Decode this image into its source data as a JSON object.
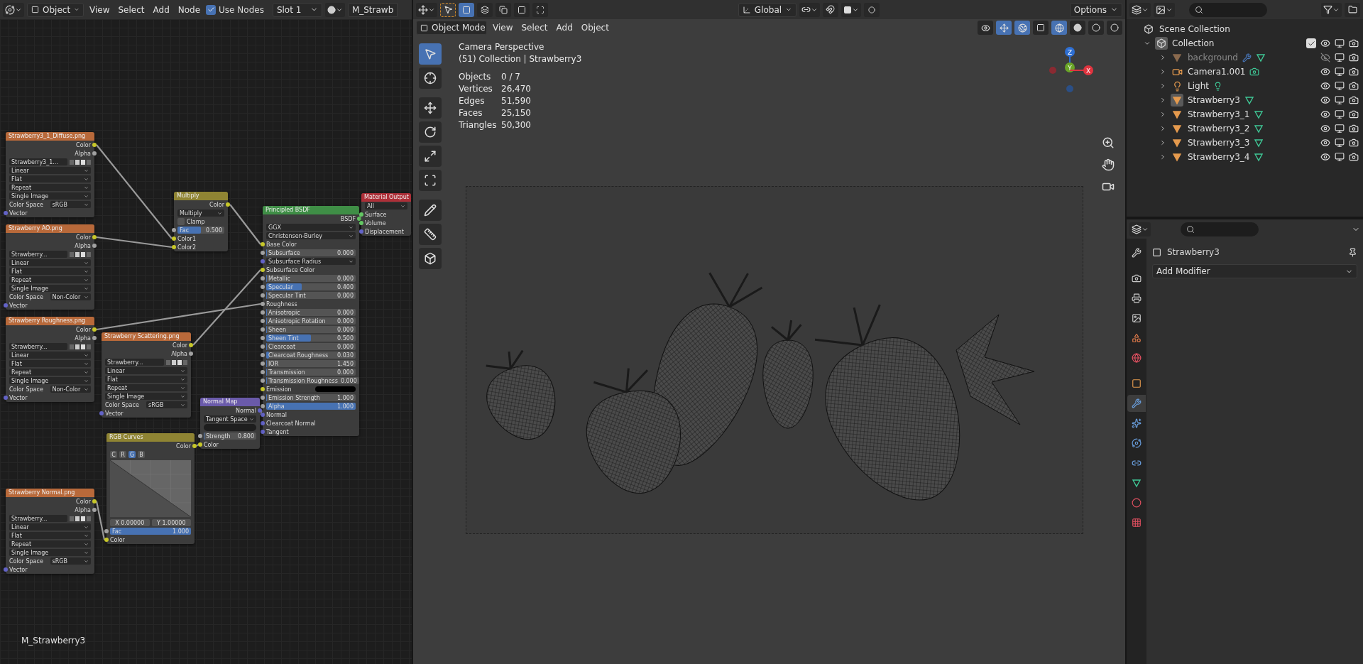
{
  "node_editor": {
    "header": {
      "mode": "Object",
      "menus": [
        "View",
        "Select",
        "Add",
        "Node"
      ],
      "use_nodes": {
        "label": "Use Nodes",
        "checked": true
      },
      "slot": "Slot 1",
      "material": "M_Strawb"
    },
    "nodes": [
      {
        "title": "Strawberry3_1_Diffuse.png",
        "color": "#b8693a",
        "rows": [
          {
            "kind": "out",
            "label": "Color",
            "color": "#c7c729"
          },
          {
            "kind": "out",
            "label": "Alpha",
            "color": "#a1a1a1"
          },
          {
            "kind": "image",
            "value": "Strawberry3_1..."
          },
          {
            "kind": "select",
            "value": "Linear"
          },
          {
            "kind": "select",
            "value": "Flat"
          },
          {
            "kind": "select",
            "value": "Repeat"
          },
          {
            "kind": "select",
            "value": "Single Image"
          },
          {
            "kind": "prop",
            "label": "Color Space",
            "value": "sRGB"
          },
          {
            "kind": "in",
            "label": "Vector",
            "color": "#6363c7"
          }
        ]
      },
      {
        "title": "Strawberry AO.png",
        "color": "#b8693a",
        "rows": [
          {
            "kind": "out",
            "label": "Color",
            "color": "#c7c729"
          },
          {
            "kind": "out",
            "label": "Alpha",
            "color": "#a1a1a1"
          },
          {
            "kind": "image",
            "value": "Strawberry..."
          },
          {
            "kind": "select",
            "value": "Linear"
          },
          {
            "kind": "select",
            "value": "Flat"
          },
          {
            "kind": "select",
            "value": "Repeat"
          },
          {
            "kind": "select",
            "value": "Single Image"
          },
          {
            "kind": "prop",
            "label": "Color Space",
            "value": "Non-Color"
          },
          {
            "kind": "in",
            "label": "Vector",
            "color": "#6363c7"
          }
        ]
      },
      {
        "title": "Strawberry Roughness.png",
        "color": "#b8693a",
        "rows": [
          {
            "kind": "out",
            "label": "Color",
            "color": "#c7c729"
          },
          {
            "kind": "out",
            "label": "Alpha",
            "color": "#a1a1a1"
          },
          {
            "kind": "image",
            "value": "Strawberry..."
          },
          {
            "kind": "select",
            "value": "Linear"
          },
          {
            "kind": "select",
            "value": "Flat"
          },
          {
            "kind": "select",
            "value": "Repeat"
          },
          {
            "kind": "select",
            "value": "Single Image"
          },
          {
            "kind": "prop",
            "label": "Color Space",
            "value": "Non-Color"
          },
          {
            "kind": "in",
            "label": "Vector",
            "color": "#6363c7"
          }
        ]
      },
      {
        "title": "Strawberry Scattering.png",
        "color": "#b8693a",
        "rows": [
          {
            "kind": "out",
            "label": "Color",
            "color": "#c7c729"
          },
          {
            "kind": "out",
            "label": "Alpha",
            "color": "#a1a1a1"
          },
          {
            "kind": "image",
            "value": "Strawberry..."
          },
          {
            "kind": "select",
            "value": "Linear"
          },
          {
            "kind": "select",
            "value": "Flat"
          },
          {
            "kind": "select",
            "value": "Repeat"
          },
          {
            "kind": "select",
            "value": "Single Image"
          },
          {
            "kind": "prop",
            "label": "Color Space",
            "value": "sRGB"
          },
          {
            "kind": "in",
            "label": "Vector",
            "color": "#6363c7"
          }
        ]
      },
      {
        "title": "Multiply",
        "color": "#8f8433",
        "rows": [
          {
            "kind": "out",
            "label": "Color",
            "color": "#c7c729"
          },
          {
            "kind": "select",
            "value": "Multiply"
          },
          {
            "kind": "check",
            "label": "Clamp",
            "checked": false
          },
          {
            "kind": "slider",
            "label": "Fac",
            "value": "0.500",
            "level": 0.5
          },
          {
            "kind": "in",
            "label": "Color1",
            "color": "#c7c729"
          },
          {
            "kind": "in",
            "label": "Color2",
            "color": "#c7c729"
          }
        ]
      },
      {
        "title": "Principled BSDF",
        "color": "#3f8e46",
        "rows": [
          {
            "kind": "out",
            "label": "BSDF",
            "color": "#63c763"
          },
          {
            "kind": "select",
            "value": "GGX"
          },
          {
            "kind": "select",
            "value": "Christensen-Burley"
          },
          {
            "kind": "in",
            "label": "Base Color",
            "color": "#c7c729"
          },
          {
            "kind": "slider",
            "label": "Subsurface",
            "value": "0.000",
            "level": 0
          },
          {
            "kind": "select",
            "value": "Subsurface Radius",
            "color": "#6363c7"
          },
          {
            "kind": "in",
            "label": "Subsurface Color",
            "color": "#c7c729"
          },
          {
            "kind": "slider",
            "label": "Metallic",
            "value": "0.000",
            "level": 0
          },
          {
            "kind": "slider",
            "label": "Specular",
            "value": "0.400",
            "level": 0.4
          },
          {
            "kind": "slider",
            "label": "Specular Tint",
            "value": "0.000",
            "level": 0
          },
          {
            "kind": "in",
            "label": "Roughness",
            "color": "#a1a1a1"
          },
          {
            "kind": "slider",
            "label": "Anisotropic",
            "value": "0.000",
            "level": 0
          },
          {
            "kind": "slider",
            "label": "Anisotropic Rotation",
            "value": "0.000",
            "level": 0
          },
          {
            "kind": "slider",
            "label": "Sheen",
            "value": "0.000",
            "level": 0
          },
          {
            "kind": "slider",
            "label": "Sheen Tint",
            "value": "0.500",
            "level": 0.5
          },
          {
            "kind": "slider",
            "label": "Clearcoat",
            "value": "0.000",
            "level": 0
          },
          {
            "kind": "slider",
            "label": "Clearcoat Roughness",
            "value": "0.030",
            "level": 0.03
          },
          {
            "kind": "slider",
            "label": "IOR",
            "value": "1.450",
            "level": 0
          },
          {
            "kind": "slider",
            "label": "Transmission",
            "value": "0.000",
            "level": 0
          },
          {
            "kind": "slider",
            "label": "Transmission Roughness",
            "value": "0.000",
            "level": 0
          },
          {
            "kind": "swatch",
            "label": "Emission"
          },
          {
            "kind": "slider",
            "label": "Emission Strength",
            "value": "1.000",
            "level": 0
          },
          {
            "kind": "slider",
            "label": "Alpha",
            "value": "1.000",
            "level": 1
          },
          {
            "kind": "in",
            "label": "Normal",
            "color": "#6363c7"
          },
          {
            "kind": "in",
            "label": "Clearcoat Normal",
            "color": "#6363c7"
          },
          {
            "kind": "in",
            "label": "Tangent",
            "color": "#6363c7"
          }
        ]
      },
      {
        "title": "Material Output",
        "color": "#ad2f38",
        "rows": [
          {
            "kind": "select",
            "value": "All"
          },
          {
            "kind": "in",
            "label": "Surface",
            "color": "#63c763"
          },
          {
            "kind": "in",
            "label": "Volume",
            "color": "#63c763"
          },
          {
            "kind": "in",
            "label": "Displacement",
            "color": "#6363c7"
          }
        ]
      },
      {
        "title": "Normal Map",
        "color": "#6a5aaa",
        "rows": [
          {
            "kind": "out",
            "label": "Normal",
            "color": "#6363c7"
          },
          {
            "kind": "select",
            "value": "Tangent Space"
          },
          {
            "kind": "field"
          },
          {
            "kind": "slider",
            "label": "Strength",
            "value": "0.800",
            "level": 0
          },
          {
            "kind": "in",
            "label": "Color",
            "color": "#c7c729"
          }
        ]
      },
      {
        "title": "RGB Curves",
        "color": "#8f8433",
        "rows": [
          {
            "kind": "out",
            "label": "Color",
            "color": "#c7c729"
          },
          {
            "kind": "curve",
            "channels": [
              {
                "label": "C",
                "selected": false
              },
              {
                "label": "R",
                "selected": false
              },
              {
                "label": "G",
                "selected": true
              },
              {
                "label": "B",
                "selected": false
              }
            ]
          },
          {
            "kind": "coords",
            "x": "X 0.00000",
            "y": "Y 1.00000"
          },
          {
            "kind": "slider",
            "label": "Fac",
            "value": "1.000",
            "level": 1
          },
          {
            "kind": "in",
            "label": "Color",
            "color": "#c7c729"
          }
        ]
      },
      {
        "title": "Strawberry Normal.png",
        "color": "#b8693a",
        "rows": [
          {
            "kind": "out",
            "label": "Color",
            "color": "#c7c729"
          },
          {
            "kind": "out",
            "label": "Alpha",
            "color": "#a1a1a1"
          },
          {
            "kind": "image",
            "value": "Strawberry..."
          },
          {
            "kind": "select",
            "value": "Linear"
          },
          {
            "kind": "select",
            "value": "Flat"
          },
          {
            "kind": "select",
            "value": "Repeat"
          },
          {
            "kind": "select",
            "value": "Single Image"
          },
          {
            "kind": "prop",
            "label": "Color Space",
            "value": "sRGB"
          },
          {
            "kind": "in",
            "label": "Vector",
            "color": "#6363c7"
          }
        ]
      }
    ],
    "material_name": "M_Strawberry3"
  },
  "viewport": {
    "header": {
      "orientation": "Global",
      "options": "Options",
      "mode": "Object Mode",
      "menus": [
        "View",
        "Select",
        "Add",
        "Object"
      ]
    },
    "tools": [
      {
        "kind": "select",
        "selected": true
      },
      {
        "kind": "cursor",
        "selected": false
      },
      {
        "kind": "move",
        "selected": false
      },
      {
        "kind": "rotate",
        "selected": false
      },
      {
        "kind": "scale",
        "selected": false
      },
      {
        "kind": "transform",
        "selected": false
      },
      {
        "kind": "annotate",
        "selected": false
      },
      {
        "kind": "measure",
        "selected": false
      },
      {
        "kind": "add_cube",
        "selected": false
      }
    ],
    "view_name": "Camera Perspective",
    "context": "(51) Collection | Strawberry3",
    "stats": [
      {
        "label": "Objects",
        "value": "0 / 7"
      },
      {
        "label": "Vertices",
        "value": "26,470"
      },
      {
        "label": "Edges",
        "value": "51,590"
      },
      {
        "label": "Faces",
        "value": "25,150"
      },
      {
        "label": "Triangles",
        "value": "50,300"
      }
    ],
    "gizmo_axes": [
      {
        "label": "Z",
        "color": "#2e6fd3"
      },
      {
        "label": "Y",
        "color": "#6aa527"
      },
      {
        "label": "X",
        "color": "#e0343f"
      }
    ]
  },
  "outliner": {
    "root": "Scene Collection",
    "collection": {
      "name": "Collection",
      "checked": true,
      "expanded": true,
      "children": [
        {
          "name": "background",
          "kind": "mesh",
          "visible": false,
          "selected": false
        },
        {
          "name": "Camera1.001",
          "kind": "camera",
          "visible": true,
          "selected": false
        },
        {
          "name": "Light",
          "kind": "light",
          "visible": true,
          "selected": false
        },
        {
          "name": "Strawberry3",
          "kind": "mesh",
          "visible": true,
          "selected": true
        },
        {
          "name": "Strawberry3_1",
          "kind": "mesh",
          "visible": true,
          "selected": false
        },
        {
          "name": "Strawberry3_2",
          "kind": "mesh",
          "visible": true,
          "selected": false
        },
        {
          "name": "Strawberry3_3",
          "kind": "mesh",
          "visible": true,
          "selected": false
        },
        {
          "name": "Strawberry3_4",
          "kind": "mesh",
          "visible": true,
          "selected": false
        }
      ]
    }
  },
  "properties": {
    "tabs": [
      {
        "kind": "tool",
        "selected": false
      },
      {
        "kind": "render",
        "selected": false
      },
      {
        "kind": "output",
        "selected": false
      },
      {
        "kind": "view_layer",
        "selected": false
      },
      {
        "kind": "scene",
        "selected": false
      },
      {
        "kind": "world",
        "selected": false
      },
      {
        "kind": "object",
        "selected": false
      },
      {
        "kind": "modifiers",
        "selected": true
      },
      {
        "kind": "particles",
        "selected": false
      },
      {
        "kind": "physics",
        "selected": false
      },
      {
        "kind": "constraints",
        "selected": false
      },
      {
        "kind": "data",
        "selected": false
      },
      {
        "kind": "material",
        "selected": false
      },
      {
        "kind": "texture",
        "selected": false
      }
    ],
    "object_name": "Strawberry3",
    "add_modifier": "Add Modifier"
  }
}
